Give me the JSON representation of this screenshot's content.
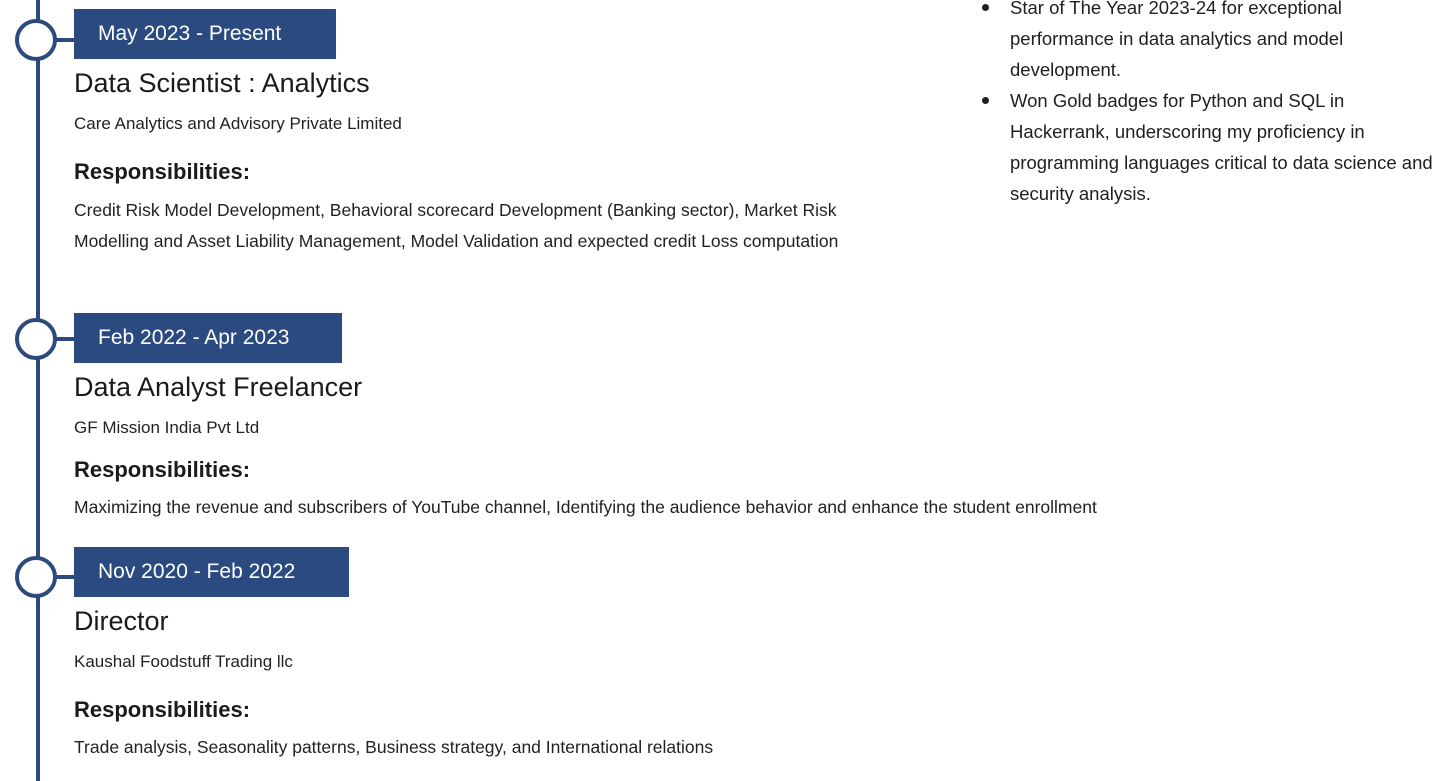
{
  "experience": [
    {
      "date": "May 2023 - Present",
      "title": "Data Scientist : Analytics",
      "company": "Care Analytics and Advisory Private Limited",
      "responsibilities_heading": "Responsibilities:",
      "responsibilities": "Credit Risk Model Development, Behavioral scorecard Development (Banking sector), Market Risk Modelling and Asset Liability Management, Model Validation and expected credit Loss computation"
    },
    {
      "date": "Feb 2022 - Apr 2023",
      "title": "Data Analyst Freelancer",
      "company": "GF Mission India Pvt Ltd",
      "responsibilities_heading": "Responsibilities:",
      "responsibilities": "Maximizing the revenue and subscribers of YouTube channel, Identifying the audience behavior and enhance the student enrollment"
    },
    {
      "date": "Nov 2020 - Feb 2022",
      "title": "Director",
      "company": "Kaushal Foodstuff Trading llc",
      "responsibilities_heading": "Responsibilities:",
      "responsibilities": "Trade analysis, Seasonality patterns, Business strategy, and International relations"
    }
  ],
  "achievements": [
    "Star of The Year 2023-24 for exceptional performance in data analytics and model development.",
    "Won Gold badges for Python and SQL in Hackerrank, underscoring my proficiency in programming languages critical to data science and security analysis."
  ],
  "colors": {
    "accent": "#2a4a80",
    "timeline": "#2d4a7c",
    "text": "#1c1c1c"
  }
}
